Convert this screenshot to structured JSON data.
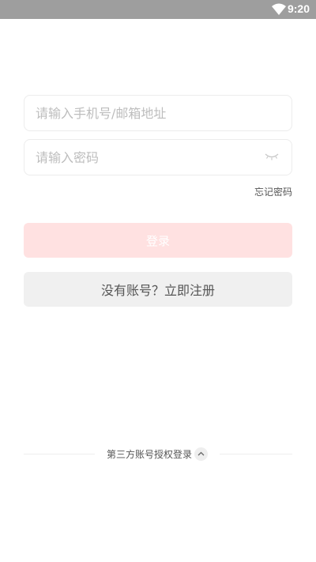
{
  "status_bar": {
    "time": "9:20"
  },
  "login_form": {
    "account_placeholder": "请输入手机号/邮箱地址",
    "password_placeholder": "请输入密码",
    "forgot_password": "忘记密码",
    "login_button": "登录",
    "register_button": "没有账号？立即注册"
  },
  "third_party": {
    "label": "第三方账号授权登录"
  },
  "icons": [
    "wifi-icon",
    "eye-closed-icon",
    "chevron-up-icon"
  ],
  "colors": {
    "status_bar": "#9e9e9e",
    "login_button_bg": "#ffe1e1",
    "register_button_bg": "#f0f0f0"
  }
}
